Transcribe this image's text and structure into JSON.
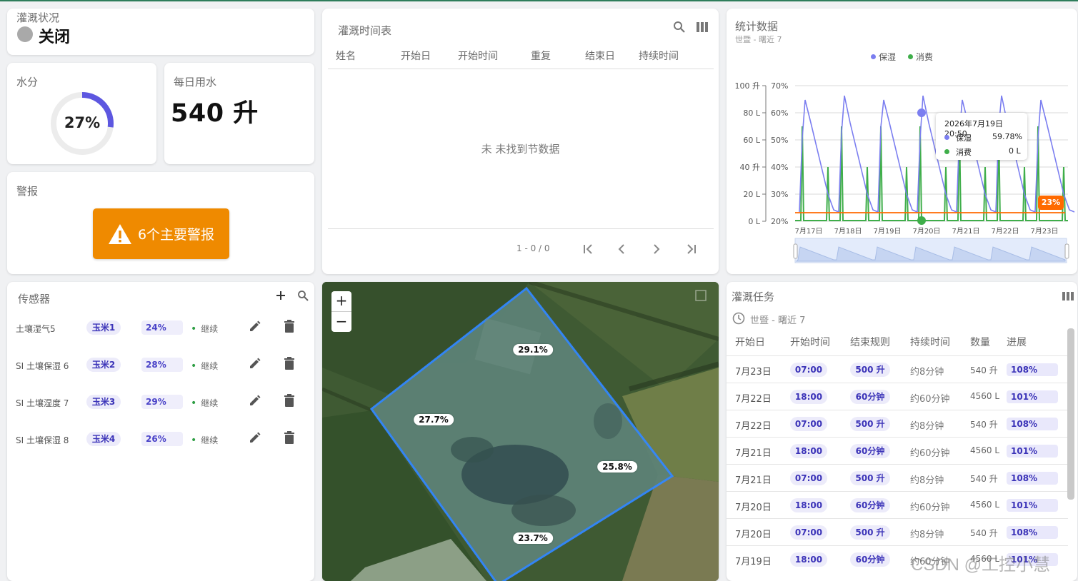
{
  "status": {
    "title": "灌溉状况",
    "value": "关闭"
  },
  "moisture": {
    "title": "水分",
    "value": "27%",
    "level": 0.27
  },
  "daily": {
    "title": "每日用水",
    "value": "540 升"
  },
  "alarm": {
    "title": "警报",
    "button": "6个主要警报"
  },
  "schedule": {
    "title": "灌溉时间表",
    "columns": [
      "姓名",
      "开始日",
      "开始时间",
      "重复",
      "结束日",
      "持续时间"
    ],
    "empty": "未 未找到节数据",
    "pagination": "1 - 0 / 0"
  },
  "stats": {
    "title": "统计数据",
    "subtitle": "世暨 - 曙近 7",
    "legend": [
      "保湿",
      "消费"
    ],
    "colors": {
      "moisture": "#7b7ef0",
      "consumption": "#3fae4a",
      "threshold": "#ff6a00"
    },
    "left_ticks": [
      "100 升",
      "80 L",
      "60 L",
      "40 升",
      "20 L",
      "0 L"
    ],
    "right_ticks": [
      "70%",
      "60%",
      "50%",
      "40%",
      "30%",
      "20%"
    ],
    "x_ticks": [
      "7月17日",
      "7月18日",
      "7月19日",
      "7月20日",
      "7月21日",
      "7月22日",
      "7月23日"
    ],
    "threshold_label": "23%",
    "tooltip": {
      "time": "2026年7月19日 20:50",
      "moisture_label": "保湿",
      "moisture_value": "59.78%",
      "consumption_label": "消费",
      "consumption_value": "0 L"
    }
  },
  "sensors": {
    "title": "传感器",
    "items": [
      {
        "name": "土壤湿气5",
        "crop": "玉米1",
        "value": "24%",
        "state": "继续"
      },
      {
        "name": "SI 土壤保湿 6",
        "crop": "玉米2",
        "value": "28%",
        "state": "继续"
      },
      {
        "name": "SI 土壤湿度 7",
        "crop": "玉米3",
        "value": "29%",
        "state": "继续"
      },
      {
        "name": "SI 土壤保湿 8",
        "crop": "玉米4",
        "value": "26%",
        "state": "继续"
      }
    ]
  },
  "map": {
    "zoom_in": "+",
    "zoom_out": "−",
    "labels": [
      "29.1%",
      "27.7%",
      "25.8%",
      "23.7%"
    ]
  },
  "tasks": {
    "title": "灌溉任务",
    "range": "世暨 - 曙近 7",
    "columns": [
      "开始日",
      "开始时间",
      "结束规则",
      "持续时间",
      "数量",
      "进展"
    ],
    "rows": [
      {
        "date": "7月23日",
        "time": "07:00",
        "rule": "500 升",
        "duration": "约8分钟",
        "qty": "540 升",
        "progress": "108%"
      },
      {
        "date": "7月22日",
        "time": "18:00",
        "rule": "60分钟",
        "duration": "约60分钟",
        "qty": "4560 L",
        "progress": "101%"
      },
      {
        "date": "7月22日",
        "time": "07:00",
        "rule": "500 升",
        "duration": "约8分钟",
        "qty": "540 升",
        "progress": "108%"
      },
      {
        "date": "7月21日",
        "time": "18:00",
        "rule": "60分钟",
        "duration": "约60分钟",
        "qty": "4560 L",
        "progress": "101%"
      },
      {
        "date": "7月21日",
        "time": "07:00",
        "rule": "500 升",
        "duration": "约8分钟",
        "qty": "540 升",
        "progress": "108%"
      },
      {
        "date": "7月20日",
        "time": "18:00",
        "rule": "60分钟",
        "duration": "约60分钟",
        "qty": "4560 L",
        "progress": "101%"
      },
      {
        "date": "7月20日",
        "time": "07:00",
        "rule": "500 升",
        "duration": "约8分钟",
        "qty": "540 升",
        "progress": "108%"
      },
      {
        "date": "7月19日",
        "time": "18:00",
        "rule": "60分钟",
        "duration": "约60分钟",
        "qty": "4560 L",
        "progress": "101%"
      }
    ]
  },
  "watermark": "CSDN @工控小慧"
}
